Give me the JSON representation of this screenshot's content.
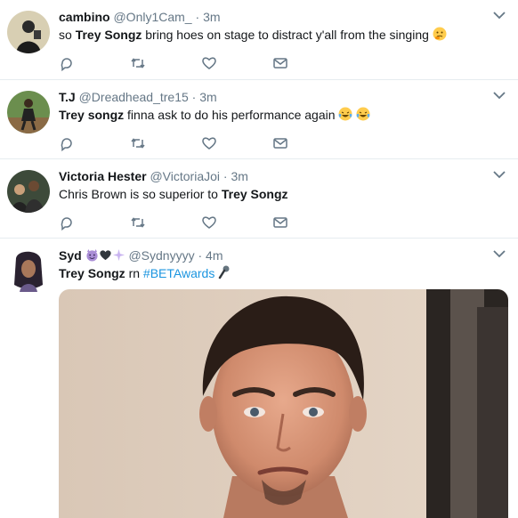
{
  "tweets": [
    {
      "name": "cambino",
      "handle": "@Only1Cam_",
      "time": "3m",
      "text_before": "so ",
      "text_bold": "Trey Songz",
      "text_after": " bring hoes on stage to distract y'all from the singing",
      "emoji": "thinking-face-emoji"
    },
    {
      "name": "T.J",
      "handle": "@Dreadhead_tre15",
      "time": "3m",
      "text_bold": "Trey songz",
      "text_after": " finna ask to do his performance again",
      "emoji": "tears-of-joy-emoji"
    },
    {
      "name": "Victoria Hester",
      "handle": "@VictoriaJoi",
      "time": "3m",
      "text_before": "Chris Brown is so superior to ",
      "text_bold": "Trey Songz"
    },
    {
      "name": "Syd",
      "handle": "@Sydnyyyy",
      "time": "4m",
      "text_bold": "Trey Songz",
      "text_after": " rn ",
      "hashtag": "#BETAwards",
      "emoji": "microphone-emoji",
      "name_emojis": "devil-heart-sparkles-emoji"
    }
  ],
  "separator": "·",
  "colors": {
    "text": "#14171a",
    "muted": "#657786",
    "link": "#1b95e0",
    "divider": "#e6ecf0"
  }
}
